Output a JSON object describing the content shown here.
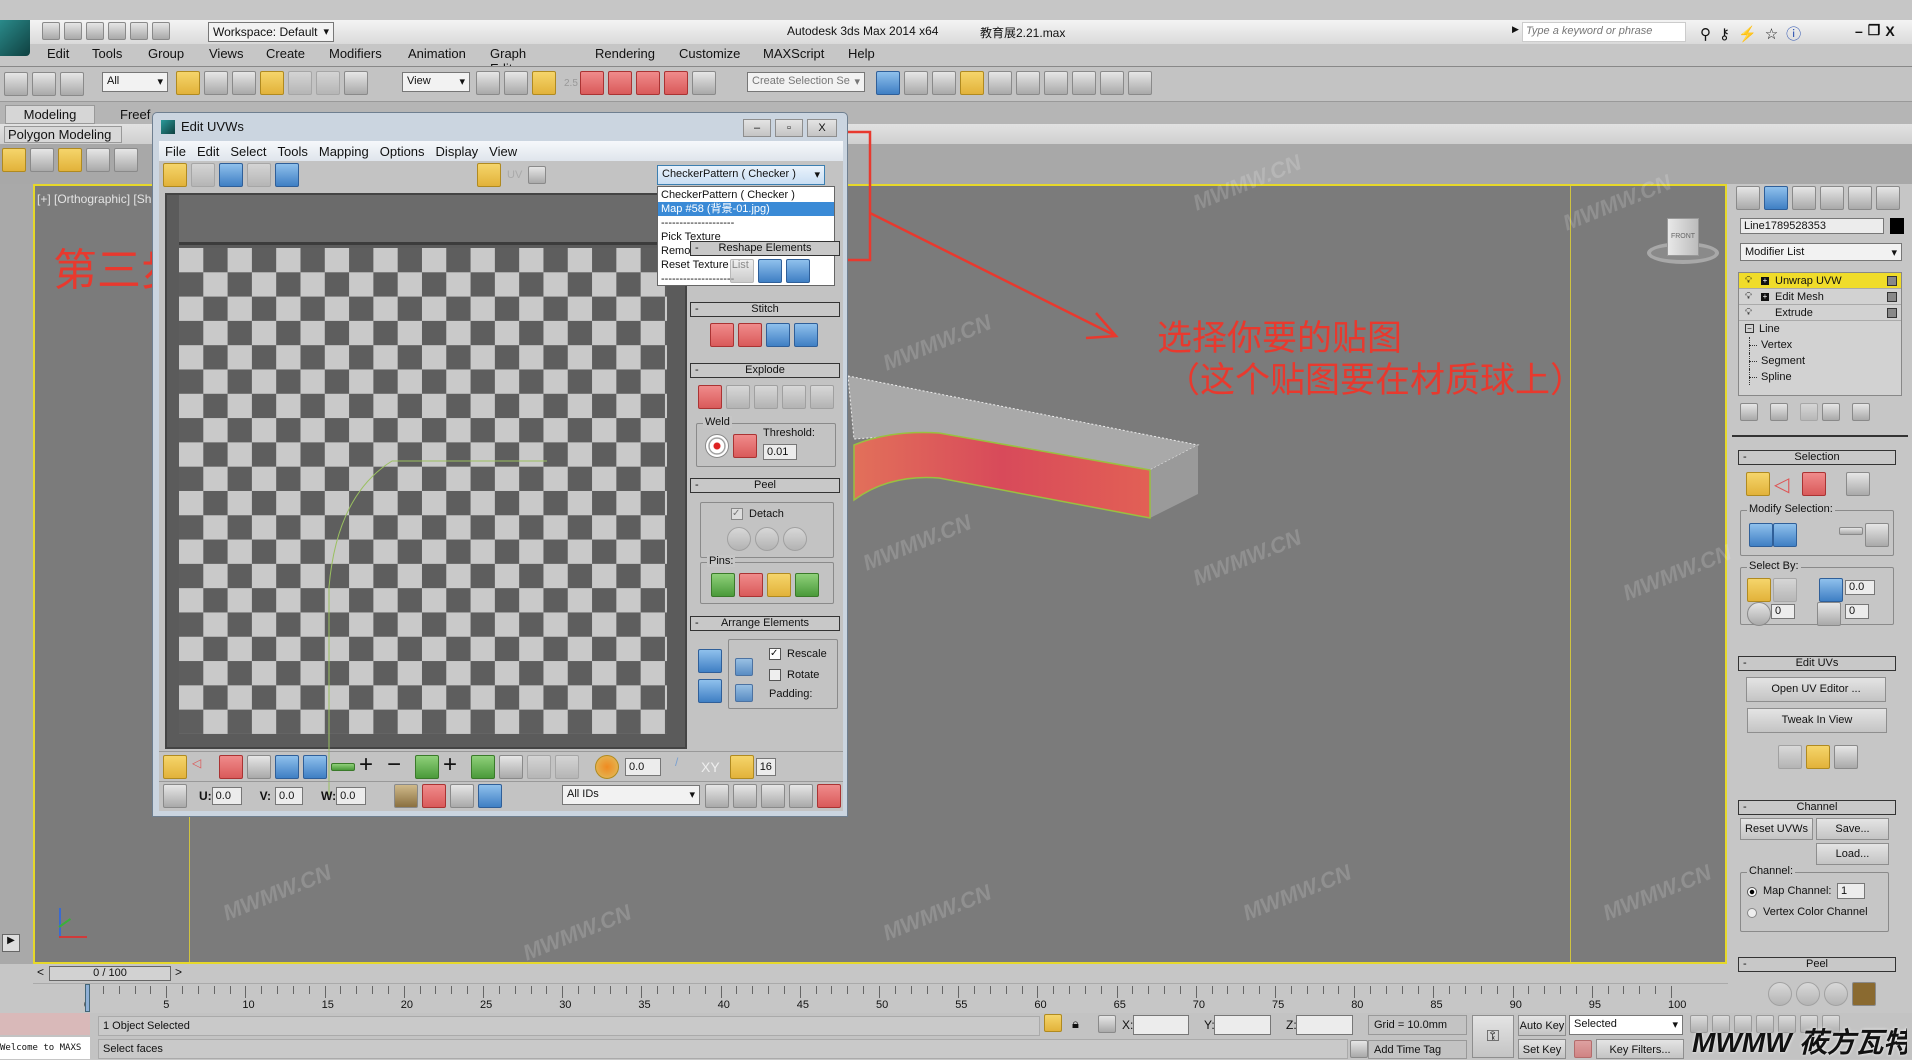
{
  "app": {
    "title": "Autodesk 3ds Max  2014 x64",
    "file": "教育展2.21.max",
    "workspace": "Workspace: Default",
    "search_placeholder": "Type a keyword or phrase"
  },
  "menu": [
    "Edit",
    "Tools",
    "Group",
    "Views",
    "Create",
    "Modifiers",
    "Animation",
    "Graph Editors",
    "Rendering",
    "Customize",
    "MAXScript",
    "Help"
  ],
  "toolbar": {
    "selection_filter": "All",
    "ref_coord": "View",
    "named_selection": "Create Selection Se",
    "snap_label": "2.5"
  },
  "ribbon": {
    "tabs": [
      "Modeling",
      "Freef"
    ],
    "panel": "Polygon Modeling"
  },
  "viewport": {
    "label": "[+] [Orthographic] [Sh",
    "annotation_step": "第三步",
    "annotation_line1": "选择你要的贴图",
    "annotation_line2": "（这个贴图要在材质球上）",
    "annotation_color": "#e8392e",
    "border_color": "#e6d82a",
    "viewcube_label": "FRONT",
    "watermark": "MWMW.CN"
  },
  "uv_editor": {
    "title": "Edit UVWs",
    "menu": [
      "File",
      "Edit",
      "Select",
      "Tools",
      "Mapping",
      "Options",
      "Display",
      "View"
    ],
    "uv_label": "UV",
    "texture_selected": "CheckerPattern  ( Checker )",
    "texture_options": [
      "CheckerPattern  ( Checker )",
      "Map #58 (背景-01.jpg)",
      "--------------------",
      "Pick Texture",
      "Remove Texture",
      "Reset Texture List",
      "--------------------"
    ],
    "highlighted_option": 1,
    "panels": {
      "reshape": "Reshape Elements",
      "stitch": "Stitch",
      "explode": "Explode",
      "weld": "Weld",
      "threshold_label": "Threshold:",
      "threshold": "0.01",
      "peel": "Peel",
      "detach": "Detach",
      "detach_checked": true,
      "pins": "Pins:",
      "arrange": "Arrange Elements",
      "rescale": "Rescale",
      "rescale_checked": true,
      "rotate": "Rotate",
      "rotate_checked": false,
      "padding": "Padding:"
    },
    "bottom": {
      "spin_value": "0.0",
      "xy_label": "XY",
      "grid_value": "16",
      "u_label": "U:",
      "u": "0.0",
      "v_label": "V:",
      "v": "0.0",
      "w_label": "W:",
      "w": "0.0",
      "ids": "All IDs"
    }
  },
  "command_panel": {
    "object_name": "Line1789528353",
    "modifier_list": "Modifier List",
    "stack": [
      {
        "label": "Unwrap UVW",
        "selected": true,
        "expand": true,
        "level": 0
      },
      {
        "label": "Edit Mesh",
        "selected": false,
        "expand": true,
        "level": 0
      },
      {
        "label": "Extrude",
        "selected": false,
        "expand": false,
        "level": 0
      },
      {
        "label": "Line",
        "selected": false,
        "expand": false,
        "level": 1
      },
      {
        "label": "Vertex",
        "selected": false,
        "expand": false,
        "level": 2
      },
      {
        "label": "Segment",
        "selected": false,
        "expand": false,
        "level": 2
      },
      {
        "label": "Spline",
        "selected": false,
        "expand": false,
        "level": 2
      }
    ],
    "selection": "Selection",
    "modify_selection": "Modify Selection:",
    "select_by": "Select By:",
    "angle": "0.0",
    "sel_a": "0",
    "sel_b": "0",
    "edit_uvs": "Edit UVs",
    "open_uv_editor": "Open UV Editor ...",
    "tweak": "Tweak In View",
    "channel": "Channel",
    "reset_uvws": "Reset UVWs",
    "save": "Save...",
    "load": "Load...",
    "channel_group": "Channel:",
    "map_channel": "Map Channel:",
    "map_channel_value": "1",
    "vertex_color": "Vertex Color Channel",
    "map_channel_selected": true,
    "peel": "Peel"
  },
  "timeline": {
    "frame": "0 / 100",
    "current": 0,
    "ticks": [
      "0",
      "5",
      "10",
      "15",
      "20",
      "25",
      "30",
      "35",
      "40",
      "45",
      "50",
      "55",
      "60",
      "65",
      "70",
      "75",
      "80",
      "85",
      "90",
      "95",
      "100"
    ]
  },
  "status": {
    "welcome": "Welcome to MAXS",
    "objects": "1 Object Selected",
    "prompt": "Select faces",
    "x_label": "X:",
    "y_label": "Y:",
    "z_label": "Z:",
    "grid": "Grid = 10.0mm",
    "add_time_tag": "Add Time Tag",
    "auto_key": "Auto Key",
    "set_key": "Set Key",
    "key_mode": "Selected",
    "key_filters": "Key Filters...",
    "logo": "MWMW 莜方瓦特"
  }
}
